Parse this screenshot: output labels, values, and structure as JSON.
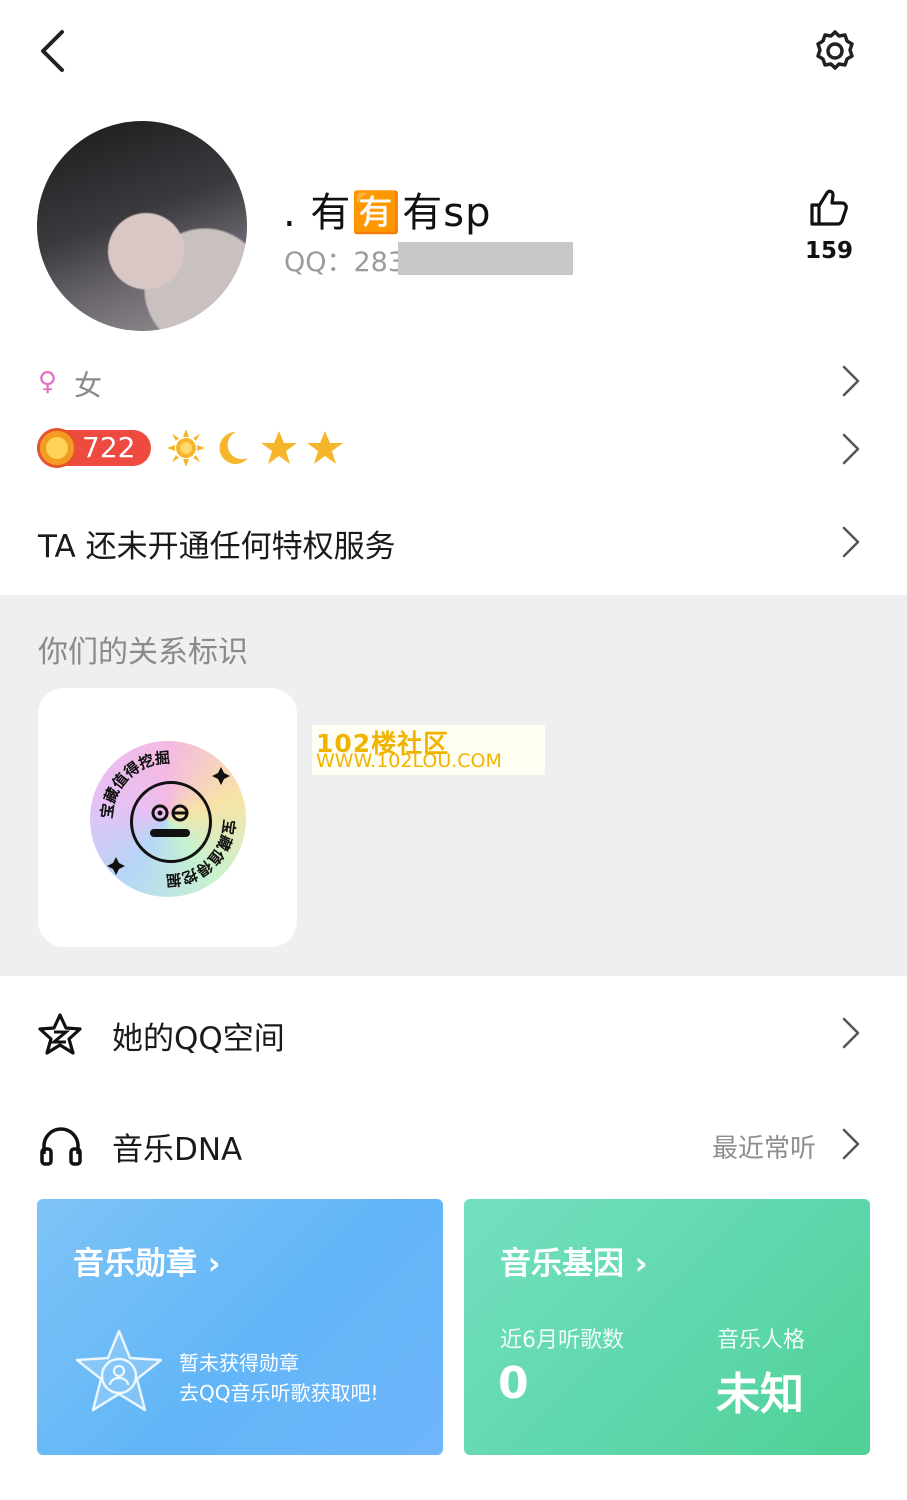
{
  "header": {
    "back_icon": "chevron-left-icon",
    "settings_icon": "gear-icon"
  },
  "profile": {
    "nickname": ". 有🈶有sp",
    "qq_label": "QQ：283",
    "like_count": "159"
  },
  "gender": {
    "symbol": "♀",
    "label": "女"
  },
  "level": {
    "value": "722"
  },
  "privilege": {
    "text": "TA 还未开通任何特权服务"
  },
  "relation": {
    "title": "你们的关系标识",
    "badge_text_top": "宝藏值得挖掘",
    "badge_text_bottom": "宝藏值得挖掘"
  },
  "watermark": {
    "line1": "102楼社区",
    "line2": "WWW.102LOU.COM"
  },
  "qzone": {
    "label": "她的QQ空间"
  },
  "music": {
    "label": "音乐DNA",
    "sub": "最近常听"
  },
  "medal_card": {
    "title": "音乐勋章 ›",
    "line1": "暂未获得勋章",
    "line2": "去QQ音乐听歌获取吧!"
  },
  "gene_card": {
    "title": "音乐基因 ›",
    "songs_label": "近6月听歌数",
    "songs_value": "0",
    "persona_label": "音乐人格",
    "persona_value": "未知"
  },
  "colors": {
    "gender": "#e86fc5",
    "level_badge": "#ee4a3f",
    "section_bg": "#efeff2",
    "medal_card": "#6fb8f7",
    "gene_card": "#5fd7ad",
    "watermark": "#f0b400"
  }
}
